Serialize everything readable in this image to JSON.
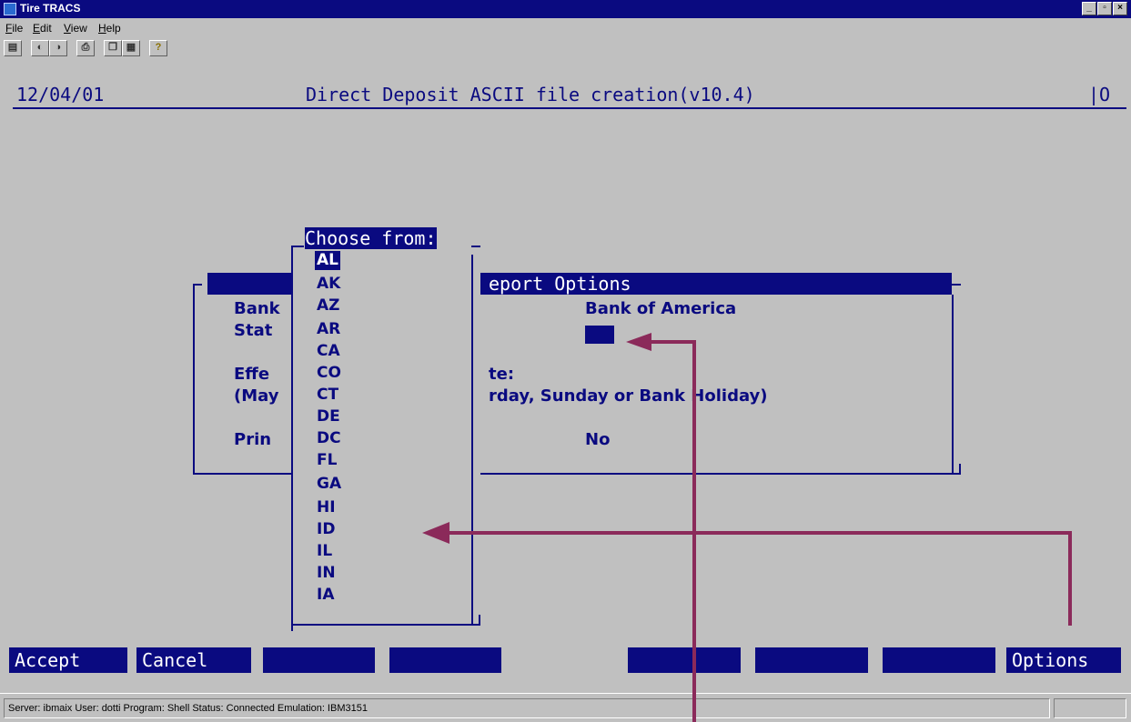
{
  "window": {
    "title": "Tire TRACS",
    "buttons": [
      "_",
      "▫",
      "×"
    ]
  },
  "menu": [
    "File",
    "Edit",
    "View",
    "Help"
  ],
  "toolbar_icons": [
    "properties-icon",
    "connect-icon",
    "disconnect-icon",
    "print-icon",
    "copy-icon",
    "paste-icon",
    "help-icon"
  ],
  "screen": {
    "date": "12/04/01",
    "heading": "Direct Deposit ASCII file creation(v10.4)",
    "indicator": "|O",
    "report_options": {
      "title": "eport Options",
      "lines": [
        "Bank",
        "Stat",
        "Effe",
        "(May",
        "Prin"
      ],
      "bank_value": "Bank of America",
      "date_label": "te:",
      "date_note": "rday, Sunday or Bank Holiday)",
      "print_value": "No"
    },
    "chooser": {
      "title": "Choose from:",
      "items": [
        "AL",
        "AK",
        "AZ",
        "AR",
        "CA",
        "CO",
        "CT",
        "DE",
        "DC",
        "FL",
        "GA",
        "HI",
        "ID",
        "IL",
        "IN",
        "IA"
      ],
      "selected": "AL"
    },
    "fkeys": {
      "accept": "Accept",
      "cancel": "Cancel",
      "options": "Options"
    }
  },
  "status": {
    "info": "Server: ibmaix   User: dotti   Program: Shell   Status: Connected   Emulation: IBM3151"
  },
  "colors": {
    "terminal_bg": "#c0c0c0",
    "terminal_fg": "#0a0a80",
    "annotation": "#8b2a5a"
  }
}
